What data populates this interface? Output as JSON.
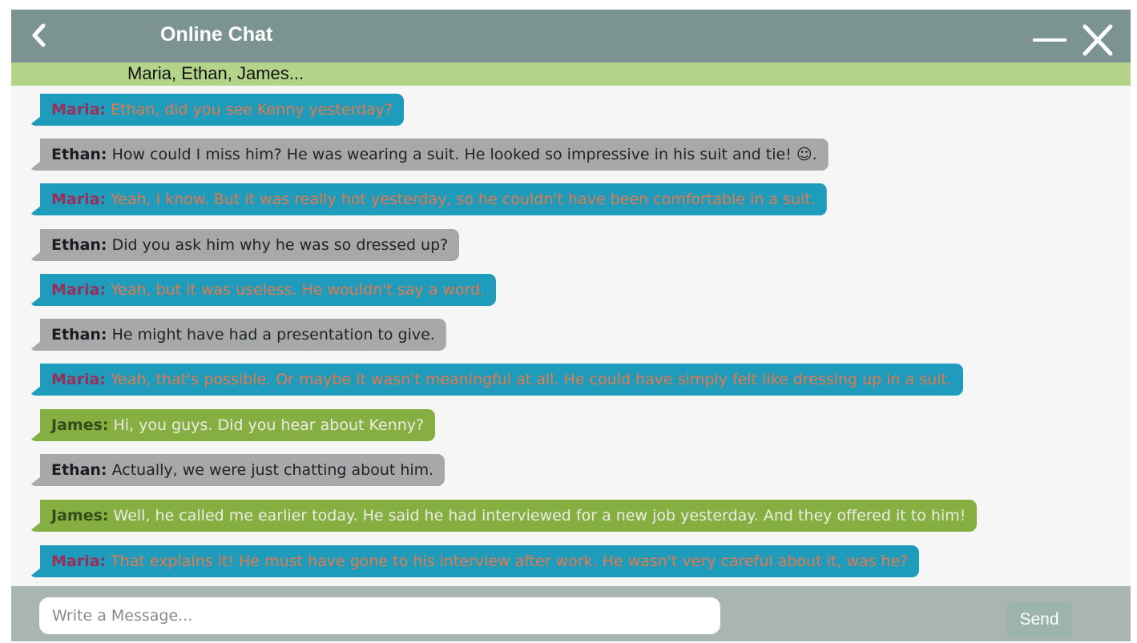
{
  "window": {
    "title": "Online Chat",
    "participants": "Maria, Ethan, James..."
  },
  "icons": {
    "back": "chevron-left-icon",
    "minimize": "minimize-icon",
    "close": "close-icon"
  },
  "colors": {
    "titlebar": "#7b9391",
    "participants_bar": "#b4d48a",
    "maria_bubble": "#1f9bbb",
    "ethan_bubble": "#a6a8a9",
    "james_bubble": "#86af42"
  },
  "messages": [
    {
      "sender": "Maria",
      "name": "Maria:",
      "text": " Ethan, did you see Kenny yesterday?"
    },
    {
      "sender": "Ethan",
      "name": "Ethan:",
      "text": " How could I miss him? He was wearing a suit. He looked so impressive in his suit and tie! ☺."
    },
    {
      "sender": "Maria",
      "name": "Maria:",
      "text": " Yeah, I know. But it was really hot yesterday, so he couldn't have been comfortable in a suit."
    },
    {
      "sender": "Ethan",
      "name": "Ethan:",
      "text": " Did you ask him why he was so dressed up?"
    },
    {
      "sender": "Maria",
      "name": "Maria:",
      "text": " Yeah, but it was useless. He wouldn't say a word."
    },
    {
      "sender": "Ethan",
      "name": "Ethan:",
      "text": " He might have had a presentation to give."
    },
    {
      "sender": "Maria",
      "name": "Maria:",
      "text": " Yeah, that's possible. Or maybe it wasn't meaningful at all. He could have simply felt like dressing up in a suit."
    },
    {
      "sender": "James",
      "name": "James:",
      "text": " Hi, you guys. Did you hear about Kenny?"
    },
    {
      "sender": "Ethan",
      "name": "Ethan:",
      "text": " Actually, we were just chatting about him."
    },
    {
      "sender": "James",
      "name": "James:",
      "text": " Well, he called me earlier today. He said he had interviewed for a new job yesterday. And they offered it to him!"
    },
    {
      "sender": "Maria",
      "name": "Maria:",
      "text": " That explains it! He must have gone to his interview after work. He wasn't very careful about it, was he?"
    }
  ],
  "composer": {
    "placeholder": "Write a Message...",
    "value": "",
    "send_label": "Send"
  }
}
